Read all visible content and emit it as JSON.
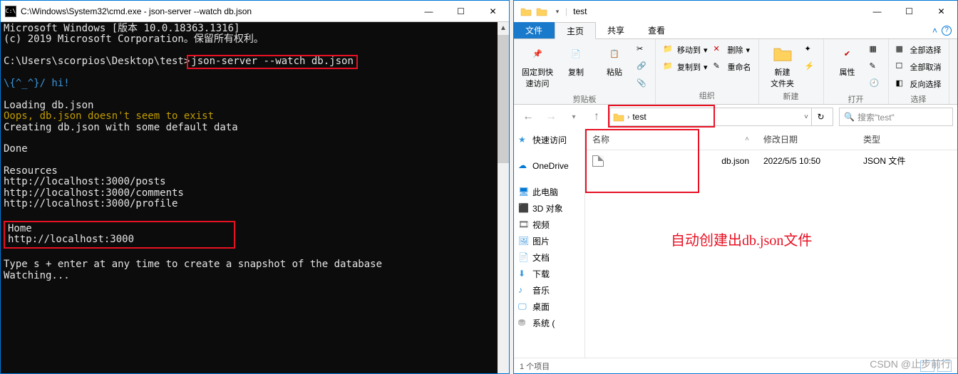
{
  "cmd": {
    "title": "C:\\Windows\\System32\\cmd.exe - json-server  --watch db.json",
    "icon_label": "C:\\",
    "line1": "Microsoft Windows [版本 10.0.18363.1316]",
    "line2": "(c) 2019 Microsoft Corporation。保留所有权利。",
    "prompt": "C:\\Users\\scorpios\\Desktop\\test>",
    "command": "json-server --watch db.json",
    "hi": "\\{^_^}/ hi!",
    "loading": "Loading db.json",
    "oops": "Oops, db.json doesn't seem to exist",
    "creating": "Creating db.json with some default data",
    "done": "Done",
    "resources": "Resources",
    "res1": "http://localhost:3000/posts",
    "res2": "http://localhost:3000/comments",
    "res3": "http://localhost:3000/profile",
    "home_label": "Home",
    "home_url": "http://localhost:3000",
    "type_hint": "Type s + enter at any time to create a snapshot of the database",
    "watching": "Watching...",
    "btn_min": "—",
    "btn_max": "☐",
    "btn_close": "✕"
  },
  "explorer": {
    "title": "test",
    "tabs": {
      "file": "文件",
      "home": "主页",
      "share": "共享",
      "view": "查看"
    },
    "ribbon": {
      "pin": "固定到快\n速访问",
      "copy": "复制",
      "paste": "粘贴",
      "cut": "剪切",
      "copy_path": "复制路径",
      "paste_shortcut": "粘贴快捷方式",
      "move_to": "移动到",
      "copy_to": "复制到",
      "delete": "删除",
      "rename": "重命名",
      "new_folder": "新建\n文件夹",
      "new_item": "新建项目",
      "easy_access": "轻松访问",
      "properties": "属性",
      "open": "打开",
      "edit": "编辑",
      "history": "历史记录",
      "select_all": "全部选择",
      "select_none": "全部取消",
      "select_invert": "反向选择",
      "grp_clipboard": "剪贴板",
      "grp_organize": "组织",
      "grp_new": "新建",
      "grp_open": "打开",
      "grp_select": "选择"
    },
    "crumb": {
      "text": "test",
      "dropdown": "v",
      "refresh": "↻"
    },
    "search": {
      "placeholder": "搜索\"test\"",
      "icon": "🔍"
    },
    "tree": {
      "quick": "快速访问",
      "onedrive": "OneDrive",
      "this_pc": "此电脑",
      "3d": "3D 对象",
      "video": "视频",
      "pictures": "图片",
      "docs": "文档",
      "downloads": "下载",
      "music": "音乐",
      "desktop": "桌面",
      "system": "系统 ("
    },
    "columns": {
      "name": "名称",
      "date": "修改日期",
      "type": "类型"
    },
    "file": {
      "name": "db.json",
      "date": "2022/5/5 10:50",
      "type": "JSON 文件"
    },
    "annotation": "自动创建出db.json文件",
    "status": "1 个项目",
    "btn_min": "—",
    "btn_max": "☐",
    "btn_close": "✕"
  },
  "watermark": "CSDN @止步前行"
}
